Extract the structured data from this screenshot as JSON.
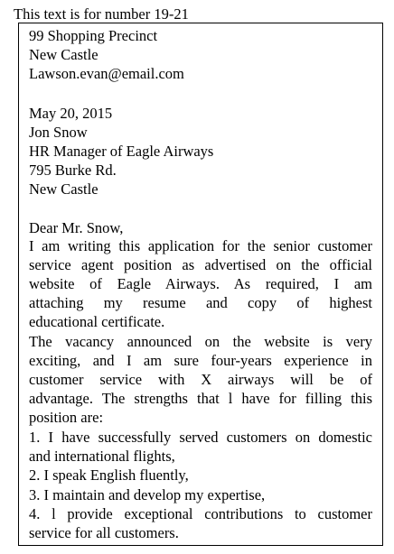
{
  "caption": "This text is for number 19-21",
  "sender": {
    "line1": "99 Shopping Precinct",
    "line2": "New Castle",
    "email": "Lawson.evan@email.com"
  },
  "date": "May 20,  2015",
  "recipient": {
    "name": "Jon Snow",
    "title": "HR Manager of Eagle Airways",
    "street": "795 Burke Rd.",
    "city": "New Castle"
  },
  "salutation": "Dear Mr.  Snow,",
  "paragraph1": [
    "I am writing this application for the senior customer",
    "service agent position as advertised on the official",
    "website of Eagle Airways.  As required, I am",
    "attaching  my  resume  and  copy  of  highest",
    "educational certificate."
  ],
  "paragraph2": [
    "The vacancy announced on the website is very",
    "exciting, and I am sure four-years experience in",
    "customer service with X airways will be of",
    "advantage. The strengths that l have for filling this",
    "position are:"
  ],
  "list": [
    "1. I have successfully served customers on domestic",
    "and international flights,",
    "2. I speak English fluently,",
    "3. I maintain and develop my expertise,",
    "4. l provide exceptional contributions to customer",
    "service for all customers."
  ]
}
